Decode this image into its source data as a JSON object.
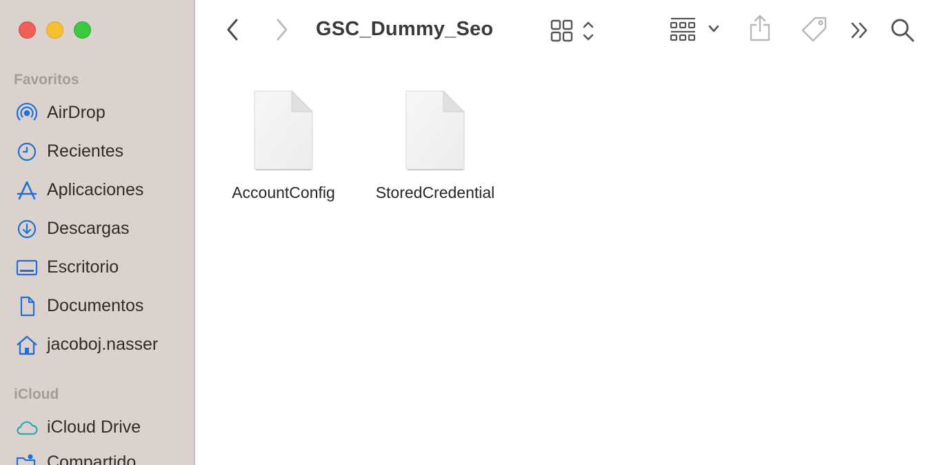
{
  "window": {
    "controls": {
      "close_color": "#ee5f56",
      "minimize_color": "#f6bf2f",
      "zoom_color": "#3cc93f"
    }
  },
  "sidebar": {
    "favorites_title": "Favoritos",
    "favorites": [
      {
        "label": "AirDrop",
        "icon": "airdrop-icon"
      },
      {
        "label": "Recientes",
        "icon": "clock-icon"
      },
      {
        "label": "Aplicaciones",
        "icon": "applications-icon"
      },
      {
        "label": "Descargas",
        "icon": "download-icon"
      },
      {
        "label": "Escritorio",
        "icon": "desktop-icon"
      },
      {
        "label": "Documentos",
        "icon": "document-icon"
      },
      {
        "label": "jacoboj.nasser",
        "icon": "home-icon"
      }
    ],
    "icloud_title": "iCloud",
    "icloud": [
      {
        "label": "iCloud Drive",
        "icon": "cloud-icon"
      },
      {
        "label": "Compartido",
        "icon": "shared-folder-icon"
      }
    ]
  },
  "toolbar": {
    "title": "GSC_Dummy_Seo",
    "icons": [
      "back-icon",
      "forward-icon",
      "icon-view-icon",
      "group-icon",
      "share-icon",
      "tag-icon",
      "more-icon",
      "search-icon"
    ]
  },
  "files": [
    {
      "name": "AccountConfig",
      "icon": "generic-file-icon"
    },
    {
      "name": "StoredCredential",
      "icon": "generic-file-icon"
    }
  ],
  "colors": {
    "accent": "#1e6fd9",
    "icloud_accent": "#2aa7b8",
    "sidebar_bg": "#dcd2cd"
  }
}
